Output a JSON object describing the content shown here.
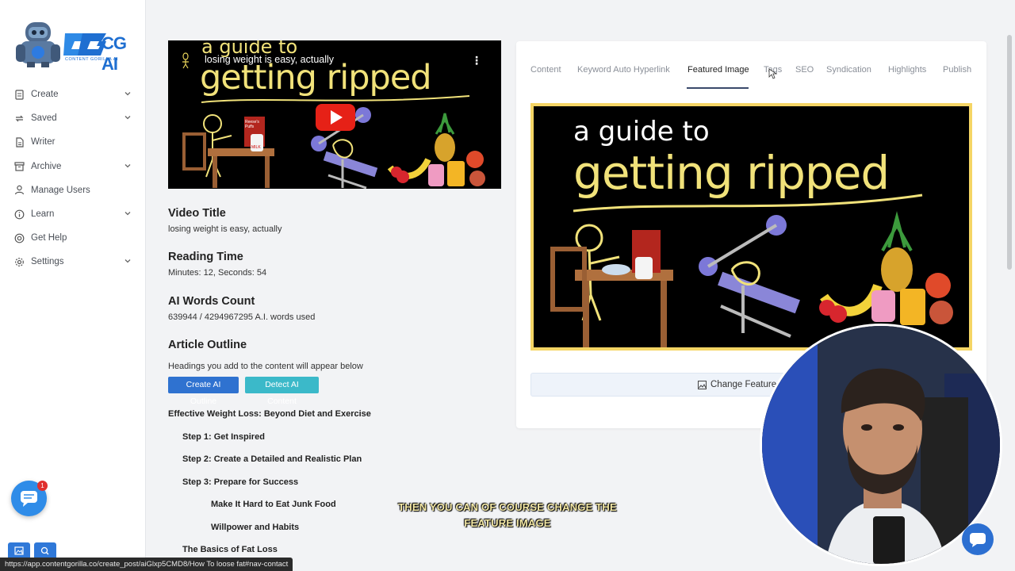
{
  "sidebar": {
    "logo_text": "CG AI",
    "logo_tagline": "CONTENT GORILLA AI",
    "items": [
      {
        "label": "Create",
        "icon": "document-icon",
        "has_chevron": true
      },
      {
        "label": "Saved",
        "icon": "sync-icon",
        "has_chevron": true
      },
      {
        "label": "Writer",
        "icon": "file-icon",
        "has_chevron": false
      },
      {
        "label": "Archive",
        "icon": "archive-icon",
        "has_chevron": true
      },
      {
        "label": "Manage Users",
        "icon": "user-icon",
        "has_chevron": false
      },
      {
        "label": "Learn",
        "icon": "info-icon",
        "has_chevron": true
      },
      {
        "label": "Get Help",
        "icon": "lifebuoy-icon",
        "has_chevron": false
      },
      {
        "label": "Settings",
        "icon": "gear-icon",
        "has_chevron": true
      }
    ],
    "chat_badge": "1"
  },
  "video": {
    "title": "losing weight is easy, actually",
    "thumb_line1": "a guide to",
    "thumb_line2": "getting ripped",
    "cereal_label": "Reese's Puffs",
    "milk_label": "MILK"
  },
  "details": {
    "video_title_h": "Video Title",
    "video_title_v": "losing weight is easy, actually",
    "reading_time_h": "Reading Time",
    "reading_time_v": "Minutes: 12, Seconds: 54",
    "words_h": "AI Words Count",
    "words_v": "639944 / 4294967295 A.I. words used",
    "outline_h": "Article Outline",
    "outline_sub": "Headings you add to the content will appear below",
    "create_outline_btn": "Create AI Outline",
    "detect_btn": "Detect AI Content"
  },
  "outline": [
    {
      "text": "Effective Weight Loss: Beyond Diet and Exercise",
      "level": 1
    },
    {
      "text": "Step 1: Get Inspired",
      "level": 2
    },
    {
      "text": "Step 2: Create a Detailed and Realistic Plan",
      "level": 2
    },
    {
      "text": "Step 3: Prepare for Success",
      "level": 2
    },
    {
      "text": "Make It Hard to Eat Junk Food",
      "level": 3
    },
    {
      "text": "Willpower and Habits",
      "level": 3
    },
    {
      "text": "The Basics of Fat Loss",
      "level": 2
    }
  ],
  "tabs": [
    {
      "label": "Content"
    },
    {
      "label": "Keyword Auto Hyperlink"
    },
    {
      "label": "Featured Image",
      "active": true
    },
    {
      "label": "Tags"
    },
    {
      "label": "SEO"
    },
    {
      "label": "Syndication"
    },
    {
      "label": "Highlights"
    },
    {
      "label": "Publish"
    }
  ],
  "featured": {
    "line1": "a guide to",
    "line2": "getting ripped",
    "change_label": "Change Featured Image"
  },
  "caption": "THEN YOU CAN OF COURSE CHANGE THE FEATURE IMAGE",
  "status_url": "https://app.contentgorilla.co/create_post/aiGlxp5CMD8/How To loose fat#nav-contact",
  "colors": {
    "primary_button": "#2f72d0",
    "teal_button": "#3bb9c9",
    "thumb_text": "#f1e27a",
    "image_border": "#f5d565"
  }
}
